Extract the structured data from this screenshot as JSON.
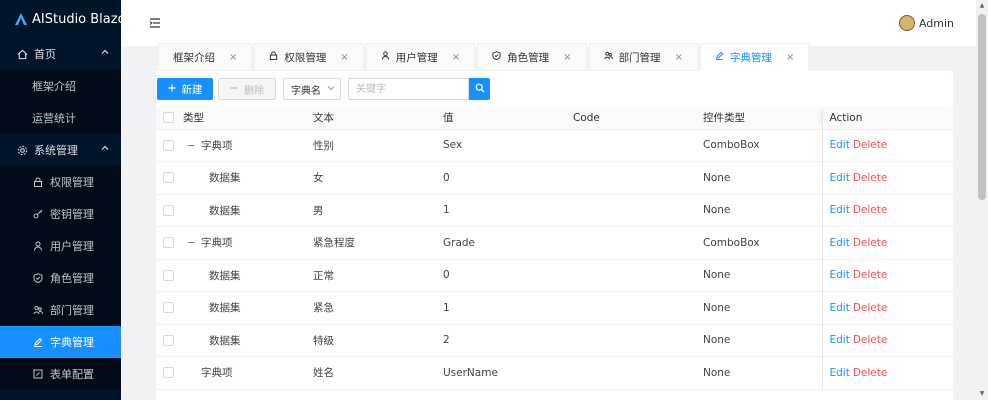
{
  "app": {
    "title": "AIStudio Blazor"
  },
  "sidebar": {
    "groups": [
      {
        "label": "首页",
        "icon": "home-icon",
        "expanded": true,
        "items": [
          {
            "label": "框架介绍"
          },
          {
            "label": "运营统计"
          }
        ]
      },
      {
        "label": "系统管理",
        "icon": "settings-icon",
        "expanded": true,
        "items": [
          {
            "label": "权限管理",
            "icon": "lock-icon"
          },
          {
            "label": "密钥管理",
            "icon": "key-icon"
          },
          {
            "label": "用户管理",
            "icon": "user-icon"
          },
          {
            "label": "角色管理",
            "icon": "shield-icon"
          },
          {
            "label": "部门管理",
            "icon": "team-icon"
          },
          {
            "label": "字典管理",
            "icon": "edit-icon",
            "active": true
          },
          {
            "label": "表单配置",
            "icon": "form-icon"
          }
        ]
      }
    ]
  },
  "header": {
    "user_name": "Admin"
  },
  "tabs": [
    {
      "label": "框架介绍",
      "icon": ""
    },
    {
      "label": "权限管理",
      "icon": "lock-icon"
    },
    {
      "label": "用户管理",
      "icon": "user-icon"
    },
    {
      "label": "角色管理",
      "icon": "shield-icon"
    },
    {
      "label": "部门管理",
      "icon": "team-icon"
    },
    {
      "label": "字典管理",
      "icon": "edit-icon",
      "active": true
    }
  ],
  "toolbar": {
    "new_label": "新建",
    "delete_label": "删除",
    "select_value": "字典名",
    "search_placeholder": "关键字"
  },
  "table": {
    "columns": [
      "类型",
      "文本",
      "值",
      "Code",
      "控件类型",
      "Action"
    ],
    "action_edit": "Edit",
    "action_delete": "Delete",
    "rows": [
      {
        "type": "字典项",
        "text": "性别",
        "value": "Sex",
        "code": "",
        "control": "ComboBox",
        "level": 0,
        "expandable": true
      },
      {
        "type": "数据集",
        "text": "女",
        "value": "0",
        "code": "",
        "control": "None",
        "level": 1
      },
      {
        "type": "数据集",
        "text": "男",
        "value": "1",
        "code": "",
        "control": "None",
        "level": 1
      },
      {
        "type": "字典项",
        "text": "紧急程度",
        "value": "Grade",
        "code": "",
        "control": "ComboBox",
        "level": 0,
        "expandable": true
      },
      {
        "type": "数据集",
        "text": "正常",
        "value": "0",
        "code": "",
        "control": "None",
        "level": 1
      },
      {
        "type": "数据集",
        "text": "紧急",
        "value": "1",
        "code": "",
        "control": "None",
        "level": 1
      },
      {
        "type": "数据集",
        "text": "特级",
        "value": "2",
        "code": "",
        "control": "None",
        "level": 1
      },
      {
        "type": "字典项",
        "text": "姓名",
        "value": "UserName",
        "code": "",
        "control": "None",
        "level": 0,
        "expandable": false
      }
    ]
  },
  "colors": {
    "primary": "#1890ff",
    "sidebar_bg": "#001529",
    "danger": "#ff4d4f"
  }
}
